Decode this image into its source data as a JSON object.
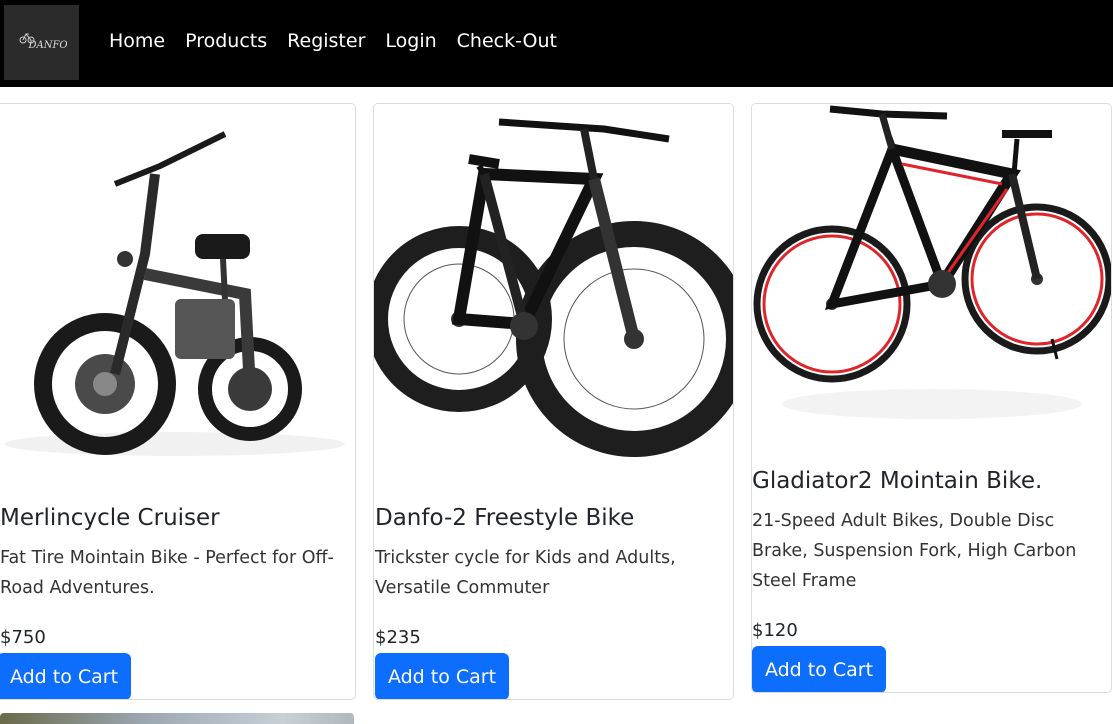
{
  "brand": {
    "logo_text": "DANFO"
  },
  "nav": {
    "items": [
      {
        "label": "Home"
      },
      {
        "label": "Products"
      },
      {
        "label": "Register"
      },
      {
        "label": "Login"
      },
      {
        "label": "Check-Out"
      }
    ]
  },
  "products": [
    {
      "title": "Merlincycle Cruiser",
      "description": "Fat Tire Mointain Bike - Perfect for Off-Road Adventures.",
      "price": "$750",
      "button_label": "Add to Cart",
      "image": "electric-folding-bike-image"
    },
    {
      "title": "Danfo-2 Freestyle Bike",
      "description": "Trickster cycle for Kids and Adults, Versatile Commuter",
      "price": "$235",
      "button_label": "Add to Cart",
      "image": "fat-tire-bike-image"
    },
    {
      "title": "Gladiator2 Mointain Bike.",
      "description": "21-Speed Adult Bikes, Double Disc Brake, Suspension Fork, High Carbon Steel Frame",
      "price": "$120",
      "button_label": "Add to Cart",
      "image": "mountain-bike-image"
    }
  ],
  "colors": {
    "navbar": "#000000",
    "button": "#0d6efd",
    "accent_red": "#e0242b"
  }
}
